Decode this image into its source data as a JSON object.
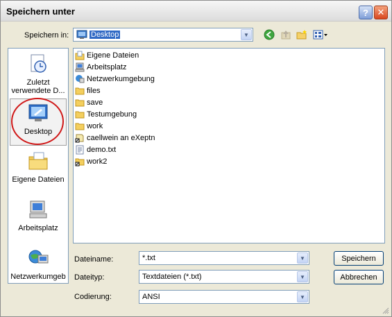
{
  "window": {
    "title": "Speichern unter"
  },
  "savein": {
    "label": "Speichern in:",
    "value": "Desktop"
  },
  "toolbar": {
    "back_icon": "back-icon",
    "up_icon": "up-folder-icon",
    "new_icon": "new-folder-icon",
    "view_icon": "view-menu-icon"
  },
  "places": [
    {
      "label": "Zuletzt verwendete D...",
      "icon": "recent-documents-icon"
    },
    {
      "label": "Desktop",
      "icon": "desktop-icon"
    },
    {
      "label": "Eigene Dateien",
      "icon": "my-documents-icon"
    },
    {
      "label": "Arbeitsplatz",
      "icon": "my-computer-icon"
    },
    {
      "label": "Netzwerkumgeb",
      "icon": "network-icon"
    }
  ],
  "files": [
    {
      "name": "Eigene Dateien",
      "icon": "my-documents-icon"
    },
    {
      "name": "Arbeitsplatz",
      "icon": "my-computer-icon"
    },
    {
      "name": "Netzwerkumgebung",
      "icon": "network-icon"
    },
    {
      "name": "files",
      "icon": "folder-icon"
    },
    {
      "name": "save",
      "icon": "folder-icon"
    },
    {
      "name": "Testumgebung",
      "icon": "folder-icon"
    },
    {
      "name": "work",
      "icon": "folder-icon"
    },
    {
      "name": "caellwein an eXeptn",
      "icon": "shortcut-icon"
    },
    {
      "name": "demo.txt",
      "icon": "text-file-icon"
    },
    {
      "name": "work2",
      "icon": "folder-shortcut-icon"
    }
  ],
  "form": {
    "filename_label": "Dateiname:",
    "filename_value": "*.txt",
    "filetype_label": "Dateityp:",
    "filetype_value": "Textdateien (*.txt)",
    "encoding_label": "Codierung:",
    "encoding_value": "ANSI"
  },
  "buttons": {
    "save": "Speichern",
    "cancel": "Abbrechen"
  },
  "colors": {
    "accent": "#316ac5",
    "highlight_circle": "#d01818",
    "window_bg": "#ece9d8"
  }
}
